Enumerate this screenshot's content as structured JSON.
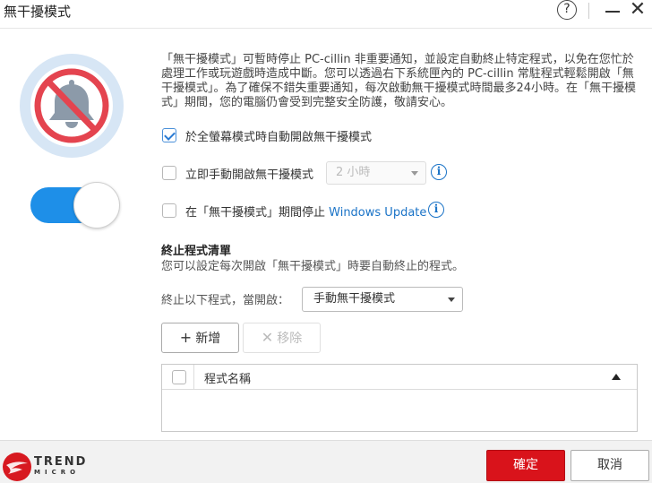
{
  "window": {
    "title": "無干擾模式",
    "help_glyph": "?",
    "close_glyph": "✕"
  },
  "description": "「無干擾模式」可暫時停止 PC-cillin 非重要通知，並設定自動終止特定程式，以免在您忙於處理工作或玩遊戲時造成中斷。您可以透過右下系統匣內的 PC-cillin 常駐程式輕鬆開啟「無干擾模式」。為了確保不錯失重要通知，每次啟動無干擾模式時間最多24小時。在「無干擾模式」期間，您的電腦仍會受到完整安全防護，敬請安心。",
  "options": {
    "fullscreen_label": "於全螢幕模式時自動開啟無干擾模式",
    "fullscreen_checked": true,
    "manual_label": "立即手動開啟無干擾模式",
    "manual_checked": false,
    "hours_value": "2 小時",
    "windows_update_prefix": "在「無干擾模式」期間停止 ",
    "windows_update_link": "Windows Update",
    "windows_update_checked": false,
    "info_glyph": "i"
  },
  "toggle": {
    "on": true
  },
  "terminate": {
    "title": "終止程式清單",
    "subtitle": "您可以設定每次開啟「無干擾模式」時要自動終止的程式。",
    "trigger_label": "終止以下程式，當開啟：",
    "trigger_value": "手動無干擾模式",
    "add_icon": "+",
    "add_label": "新增",
    "remove_icon": "✕",
    "remove_label": "移除",
    "table": {
      "column_name": "程式名稱",
      "rows": []
    }
  },
  "footer": {
    "brand_line1": "TREND",
    "brand_line2": "MICRO",
    "ok_label": "確定",
    "cancel_label": "取消"
  },
  "colors": {
    "accent_blue": "#1e8fe8",
    "brand_red": "#d9131b",
    "hero_bg": "#d7e6f5"
  }
}
